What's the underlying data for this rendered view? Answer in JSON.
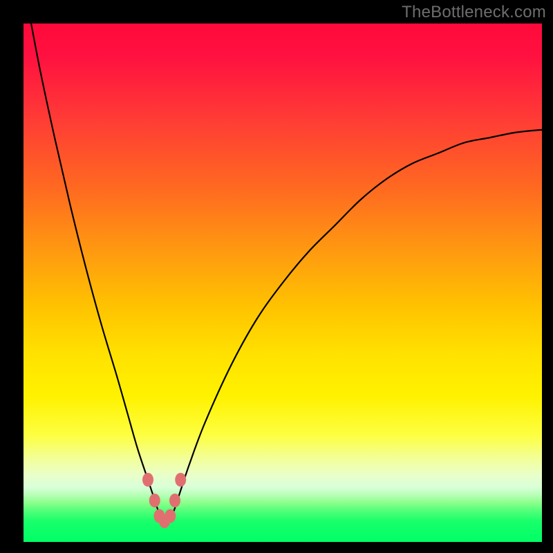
{
  "watermark": "TheBottleneck.com",
  "colors": {
    "frame": "#000000",
    "watermark_text": "#6d6d6d",
    "curve": "#000000",
    "marker": "#e07070",
    "gradient_stops": [
      {
        "pos": 0,
        "color": "#ff0a3a"
      },
      {
        "pos": 0.5,
        "color": "#ffc400"
      },
      {
        "pos": 0.8,
        "color": "#fdff42"
      },
      {
        "pos": 1.0,
        "color": "#00ff66"
      }
    ]
  },
  "chart_data": {
    "type": "line",
    "title": "",
    "xlabel": "",
    "ylabel": "",
    "xlim": [
      0,
      100
    ],
    "ylim": [
      0,
      100
    ],
    "grid": false,
    "note": "Bottleneck-style curve. x is normalized horizontal position (0–100 left→right across the gradient area). y is normalized vertical position where 0 = top (red/high) and 100 = bottom (green/low). Minimum (best balance) near x≈27.",
    "x": [
      0,
      3,
      6,
      9,
      12,
      15,
      18,
      20,
      22,
      24,
      25,
      26,
      27,
      28,
      29,
      30,
      32,
      35,
      40,
      45,
      50,
      55,
      60,
      65,
      70,
      75,
      80,
      85,
      90,
      95,
      100
    ],
    "y": [
      -8,
      8,
      22,
      35,
      47,
      58,
      68,
      75,
      82,
      88,
      91,
      94,
      96,
      96,
      94,
      91,
      85,
      77,
      66,
      57,
      50,
      44,
      39,
      34,
      30,
      27,
      25,
      23,
      22,
      21,
      20.5
    ],
    "markers": [
      {
        "x": 24.0,
        "y": 88
      },
      {
        "x": 25.3,
        "y": 92
      },
      {
        "x": 26.2,
        "y": 95
      },
      {
        "x": 27.2,
        "y": 96
      },
      {
        "x": 28.3,
        "y": 95
      },
      {
        "x": 29.2,
        "y": 92
      },
      {
        "x": 30.3,
        "y": 88
      }
    ]
  }
}
